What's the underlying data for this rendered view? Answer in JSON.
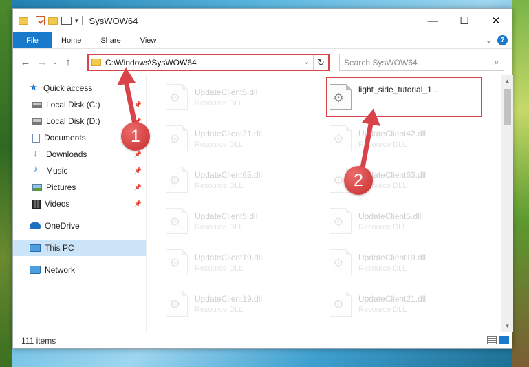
{
  "window": {
    "title": "SysWOW64",
    "controls": {
      "minimize": "—",
      "maximize": "☐",
      "close": "✕"
    }
  },
  "ribbon": {
    "tabs": [
      "File",
      "Home",
      "Share",
      "View"
    ],
    "collapse_icon": "chevron-down-icon",
    "help_label": "?"
  },
  "navigation": {
    "back": "←",
    "forward": "→",
    "recent": "⌄",
    "up": "↑",
    "address_path": "C:\\Windows\\SysWOW64",
    "refresh": "↻",
    "address_dropdown": "⌄",
    "search_placeholder": "Search SysWOW64",
    "search_icon": "⌕"
  },
  "sidebar": {
    "items": [
      {
        "label": "Quick access",
        "icon": "star-icon"
      },
      {
        "label": "Local Disk (C:)",
        "icon": "disk-icon",
        "pinned": true
      },
      {
        "label": "Local Disk (D:)",
        "icon": "disk-icon",
        "pinned": true
      },
      {
        "label": "Documents",
        "icon": "documents-icon",
        "pinned": true
      },
      {
        "label": "Downloads",
        "icon": "downloads-icon",
        "pinned": true
      },
      {
        "label": "Music",
        "icon": "music-icon",
        "pinned": true
      },
      {
        "label": "Pictures",
        "icon": "pictures-icon",
        "pinned": true
      },
      {
        "label": "Videos",
        "icon": "videos-icon",
        "pinned": true
      },
      {
        "label": "OneDrive",
        "icon": "onedrive-icon"
      },
      {
        "label": "This PC",
        "icon": "this-pc-icon",
        "selected": true
      },
      {
        "label": "Network",
        "icon": "network-icon"
      }
    ],
    "pin_glyph": "📌"
  },
  "files": {
    "left_column": [
      {
        "name": "UpdateClient5.dll",
        "type": "Resource DLL"
      },
      {
        "name": "UpdateClient21.dll",
        "type": "Resource DLL"
      },
      {
        "name": "UpdateClient65.dll",
        "type": "Resource DLL"
      },
      {
        "name": "UpdateClient5.dll",
        "type": "Resource DLL"
      },
      {
        "name": "UpdateClient19.dll",
        "type": "Resource DLL"
      },
      {
        "name": "UpdateClient19.dll",
        "type": "Resource DLL"
      }
    ],
    "right_column": [
      {
        "name": "light_side_tutorial_1...",
        "type": ""
      },
      {
        "name": "UpdateClient42.dll",
        "type": "Resource DLL"
      },
      {
        "name": "UpdateClient63.dll",
        "type": "Resource DLL"
      },
      {
        "name": "UpdateClient5.dll",
        "type": "Resource DLL"
      },
      {
        "name": "UpdateClient19.dll",
        "type": "Resource DLL"
      },
      {
        "name": "UpdateClient21.dll",
        "type": "Resource DLL"
      }
    ]
  },
  "status": {
    "item_count": "111 items"
  },
  "annotations": {
    "step1": "1",
    "step2": "2",
    "highlight_color": "#d9434a"
  }
}
